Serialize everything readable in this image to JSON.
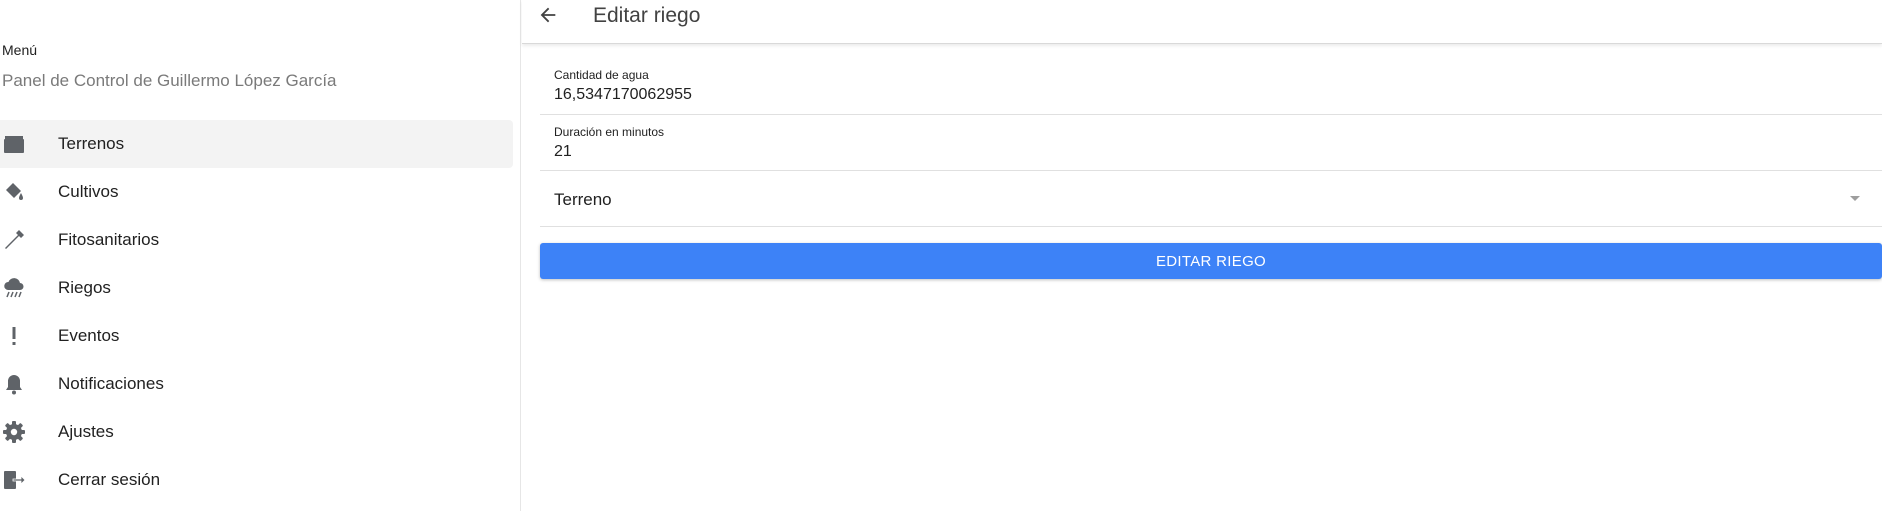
{
  "sidebar": {
    "menu_title": "Menú",
    "subtitle": "Panel de Control de Guillermo López García",
    "items": [
      {
        "label": "Terrenos",
        "icon": "box-icon",
        "active": true
      },
      {
        "label": "Cultivos",
        "icon": "paint-bucket-icon",
        "active": false
      },
      {
        "label": "Fitosanitarios",
        "icon": "dropper-icon",
        "active": false
      },
      {
        "label": "Riegos",
        "icon": "rain-cloud-icon",
        "active": false
      },
      {
        "label": "Eventos",
        "icon": "exclamation-icon",
        "active": false
      },
      {
        "label": "Notificaciones",
        "icon": "bell-icon",
        "active": false
      },
      {
        "label": "Ajustes",
        "icon": "gear-icon",
        "active": false
      },
      {
        "label": "Cerrar sesión",
        "icon": "logout-icon",
        "active": false
      }
    ]
  },
  "header": {
    "title": "Editar riego",
    "back_icon": "arrow-left-icon"
  },
  "form": {
    "water": {
      "label": "Cantidad de agua",
      "value": "16,5347170062955"
    },
    "duration": {
      "label": "Duración en minutos",
      "value": "21"
    },
    "terrain": {
      "label": "Terreno"
    },
    "submit_label": "EDITAR RIEGO"
  },
  "colors": {
    "accent": "#3d82f7",
    "icon": "#5f6368",
    "active_bg": "#f3f3f3"
  }
}
